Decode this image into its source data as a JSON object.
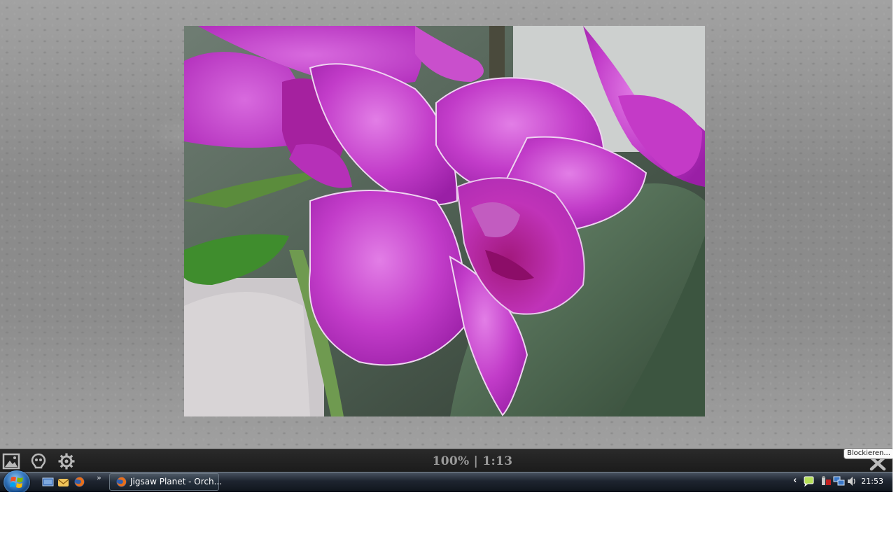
{
  "puzzle": {
    "status_text": "100% | 1:13",
    "tooltip": "Blockieren..."
  },
  "toolbar_icons": [
    "image-preview-icon",
    "ghost-image-icon",
    "settings-gear-icon",
    "close-x-icon"
  ],
  "taskbar": {
    "quicklaunch_icons": [
      "show-desktop-icon",
      "thunderbird-icon",
      "firefox-icon"
    ],
    "quicklaunch_more": "»",
    "active_task_label": "Jigsaw Planet - Orch...",
    "tray_expand": "‹",
    "clock": "21:53"
  },
  "colors": {
    "orchid_petal": "#c238c9",
    "orchid_center": "#8a1070",
    "toolbar_bg": "#1b1b1b",
    "workspace_bg": "#8e8e8e"
  }
}
